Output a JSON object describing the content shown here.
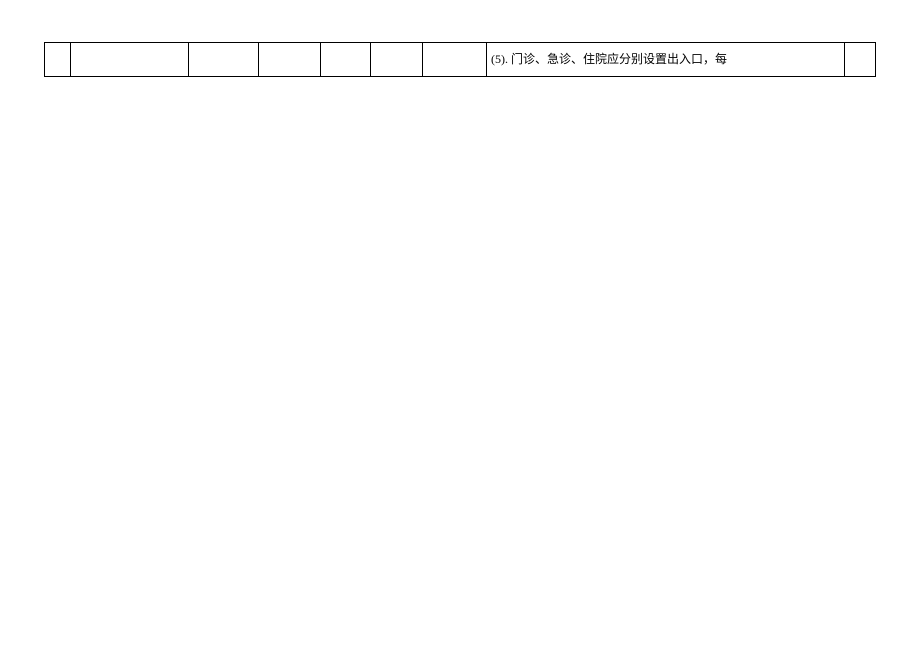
{
  "table": {
    "row": {
      "cells": {
        "c1": "",
        "c2": "",
        "c3": "",
        "c4": "",
        "c5": "",
        "c6": "",
        "c7": "",
        "c8": "(5). 门诊、急诊、住院应分别设置出入口，每",
        "c9": ""
      }
    }
  }
}
